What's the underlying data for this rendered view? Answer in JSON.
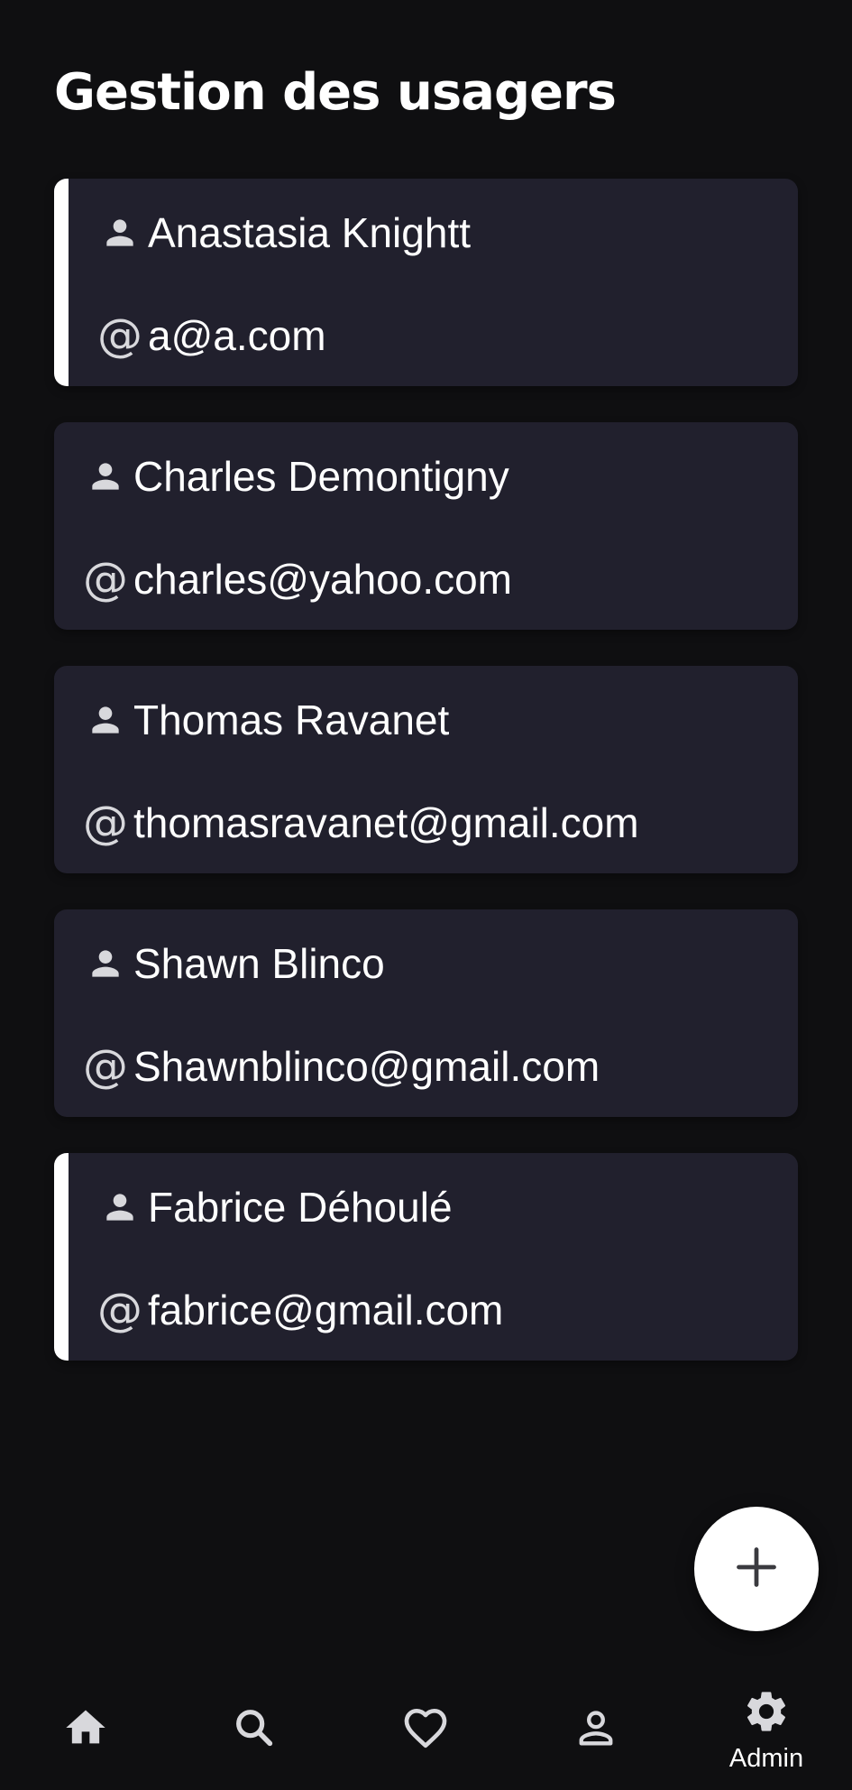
{
  "header": {
    "title": "Gestion des usagers"
  },
  "users": [
    {
      "name": "Anastasia Knightt",
      "email": "a@a.com",
      "selected": true
    },
    {
      "name": "Charles Demontigny",
      "email": "charles@yahoo.com",
      "selected": false
    },
    {
      "name": "Thomas Ravanet",
      "email": "thomasravanet@gmail.com",
      "selected": false
    },
    {
      "name": "Shawn Blinco",
      "email": "Shawnblinco@gmail.com",
      "selected": false
    },
    {
      "name": "Fabrice Déhoulé",
      "email": "fabrice@gmail.com",
      "selected": true
    }
  ],
  "icons": {
    "name": "person-icon",
    "email": "at-sign-icon",
    "at_glyph": "@",
    "fab": "plus-icon"
  },
  "bottom_nav": {
    "items": [
      {
        "icon": "home-icon",
        "label": ""
      },
      {
        "icon": "search-icon",
        "label": ""
      },
      {
        "icon": "heart-icon",
        "label": ""
      },
      {
        "icon": "profile-icon",
        "label": ""
      },
      {
        "icon": "gear-icon",
        "label": "Admin",
        "active": true
      }
    ]
  },
  "colors": {
    "background": "#0f0f11",
    "card": "#21202d",
    "accent": "#ffffff",
    "icon": "#d8d8dc"
  }
}
